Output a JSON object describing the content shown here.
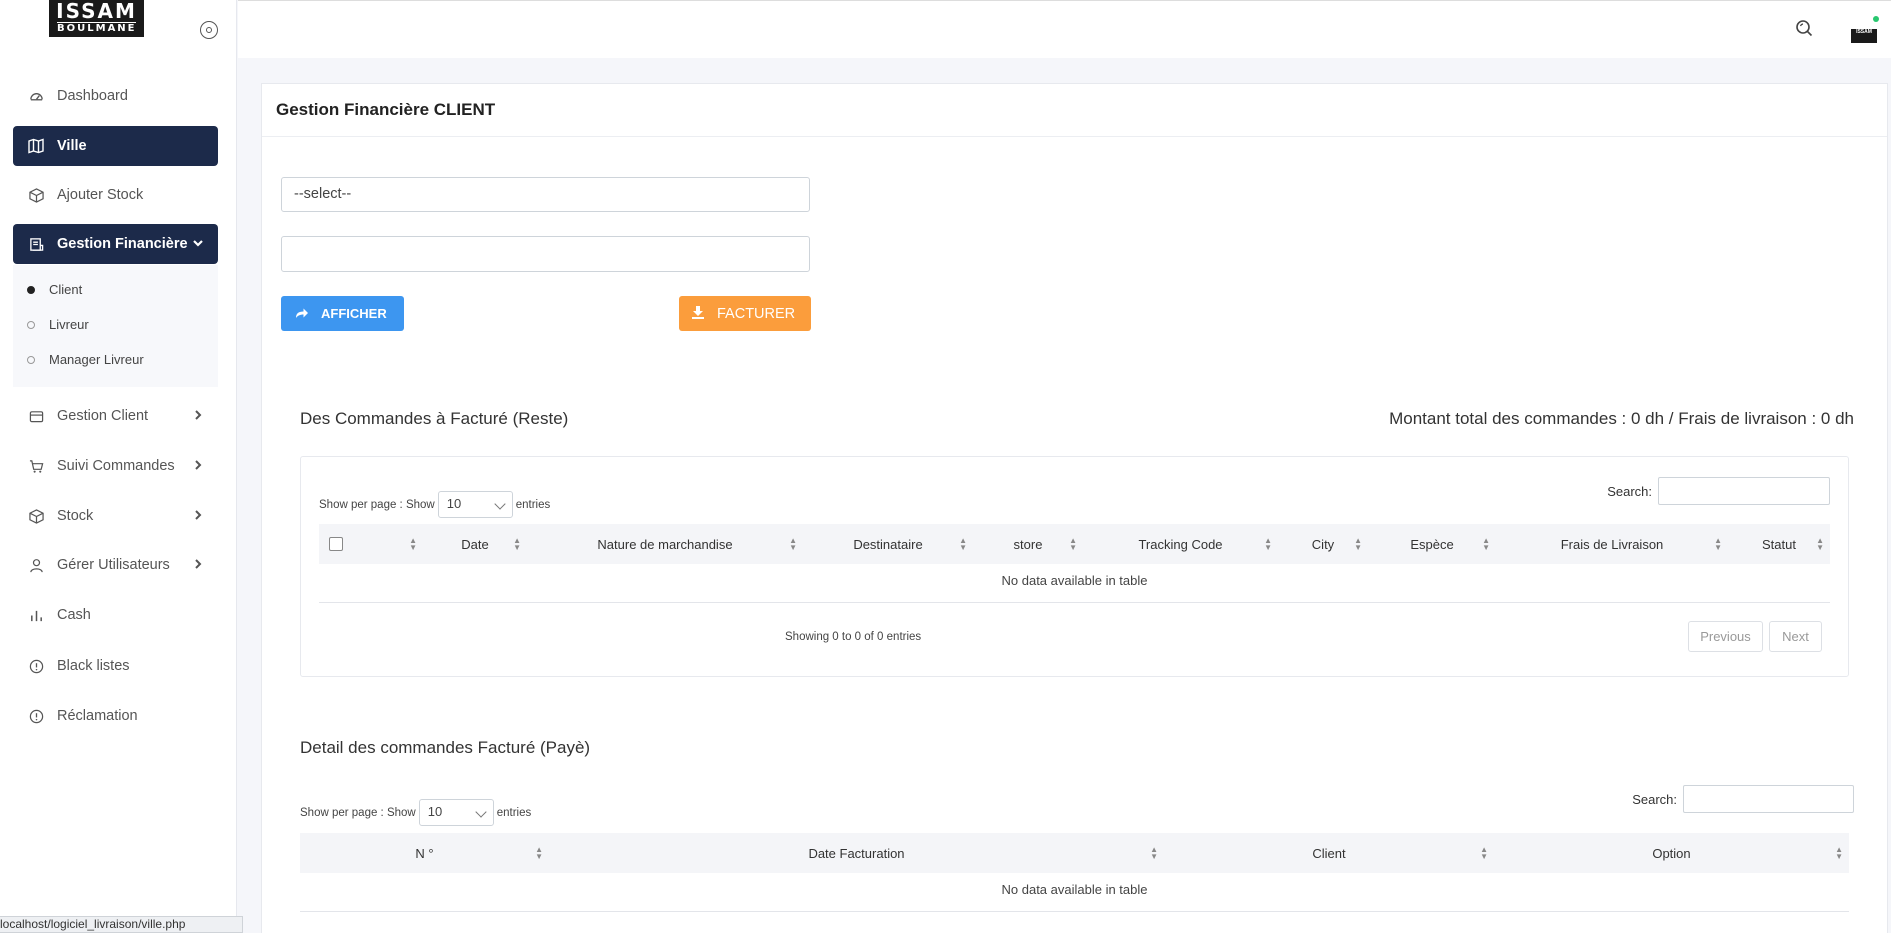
{
  "brand": {
    "logo_line1": "ISSAM",
    "logo_line2": "BOULMANE",
    "avatar_text": "ISSAM"
  },
  "sidebar": {
    "items": [
      {
        "label": "Dashboard"
      },
      {
        "label": "Ville"
      },
      {
        "label": "Ajouter Stock"
      },
      {
        "label": "Gestion Financière"
      },
      {
        "label": "Gestion Client"
      },
      {
        "label": "Suivi Commandes"
      },
      {
        "label": "Stock"
      },
      {
        "label": "Gérer Utilisateurs"
      },
      {
        "label": "Cash"
      },
      {
        "label": "Black listes"
      },
      {
        "label": "Réclamation"
      }
    ],
    "submenu": [
      {
        "label": "Client"
      },
      {
        "label": "Livreur"
      },
      {
        "label": "Manager Livreur"
      }
    ]
  },
  "status_bar": {
    "url": "localhost/logiciel_livraison/ville.php"
  },
  "card": {
    "title": "Gestion Financière CLIENT",
    "select_value": "--select--",
    "afficher_label": "AFFICHER",
    "facturer_label": "FACTURER"
  },
  "section1": {
    "title": "Des Commandes à Facturé (Reste)",
    "total": "Montant total des commandes : 0 dh / Frais de livraison : 0 dh",
    "length_prefix": "Show per page :  Show",
    "length_value": "10",
    "length_suffix": "entries",
    "search_label": "Search:",
    "columns": [
      "Date",
      "Nature de marchandise",
      "Destinataire",
      "store",
      "Tracking Code",
      "City",
      "Espèce",
      "Frais de Livraison",
      "Statut"
    ],
    "empty": "No data available in table",
    "info": "Showing 0 to 0 of 0 entries",
    "prev": "Previous",
    "next": "Next"
  },
  "section2": {
    "title": "Detail des commandes Facturé (Payè)",
    "length_prefix": "Show per page :  Show",
    "length_value": "10",
    "length_suffix": "entries",
    "search_label": "Search:",
    "columns": [
      "N °",
      "Date Facturation",
      "Client",
      "Option"
    ],
    "empty": "No data available in table"
  },
  "colors": {
    "sidebar_active": "#1c2a4a",
    "afficher": "#3d96f0",
    "facturer": "#fb9d3c",
    "online": "#28c76f"
  }
}
